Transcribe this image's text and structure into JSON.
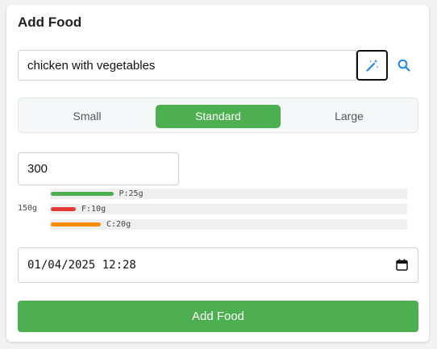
{
  "card": {
    "title": "Add Food"
  },
  "search": {
    "value": "chicken with vegetables",
    "magic_icon": "magic-wand-icon",
    "search_icon": "search-icon"
  },
  "portion": {
    "options": [
      "Small",
      "Standard",
      "Large"
    ],
    "selected": "Standard"
  },
  "quantity": {
    "value": "300"
  },
  "macros": {
    "weight": "150g",
    "items": [
      {
        "key": "protein",
        "label": "P:25g",
        "grams": 25,
        "color": "#4caf50"
      },
      {
        "key": "fat",
        "label": "F:10g",
        "grams": 10,
        "color": "#e53935"
      },
      {
        "key": "carbs",
        "label": "C:20g",
        "grams": 20,
        "color": "#fb8c00"
      }
    ]
  },
  "datetime": {
    "value": "01/04/2025 12:28",
    "icon": "calendar-icon"
  },
  "submit": {
    "label": "Add Food",
    "color": "#4caf50"
  },
  "accent_color": "#4caf50",
  "link_color": "#1e88e5"
}
